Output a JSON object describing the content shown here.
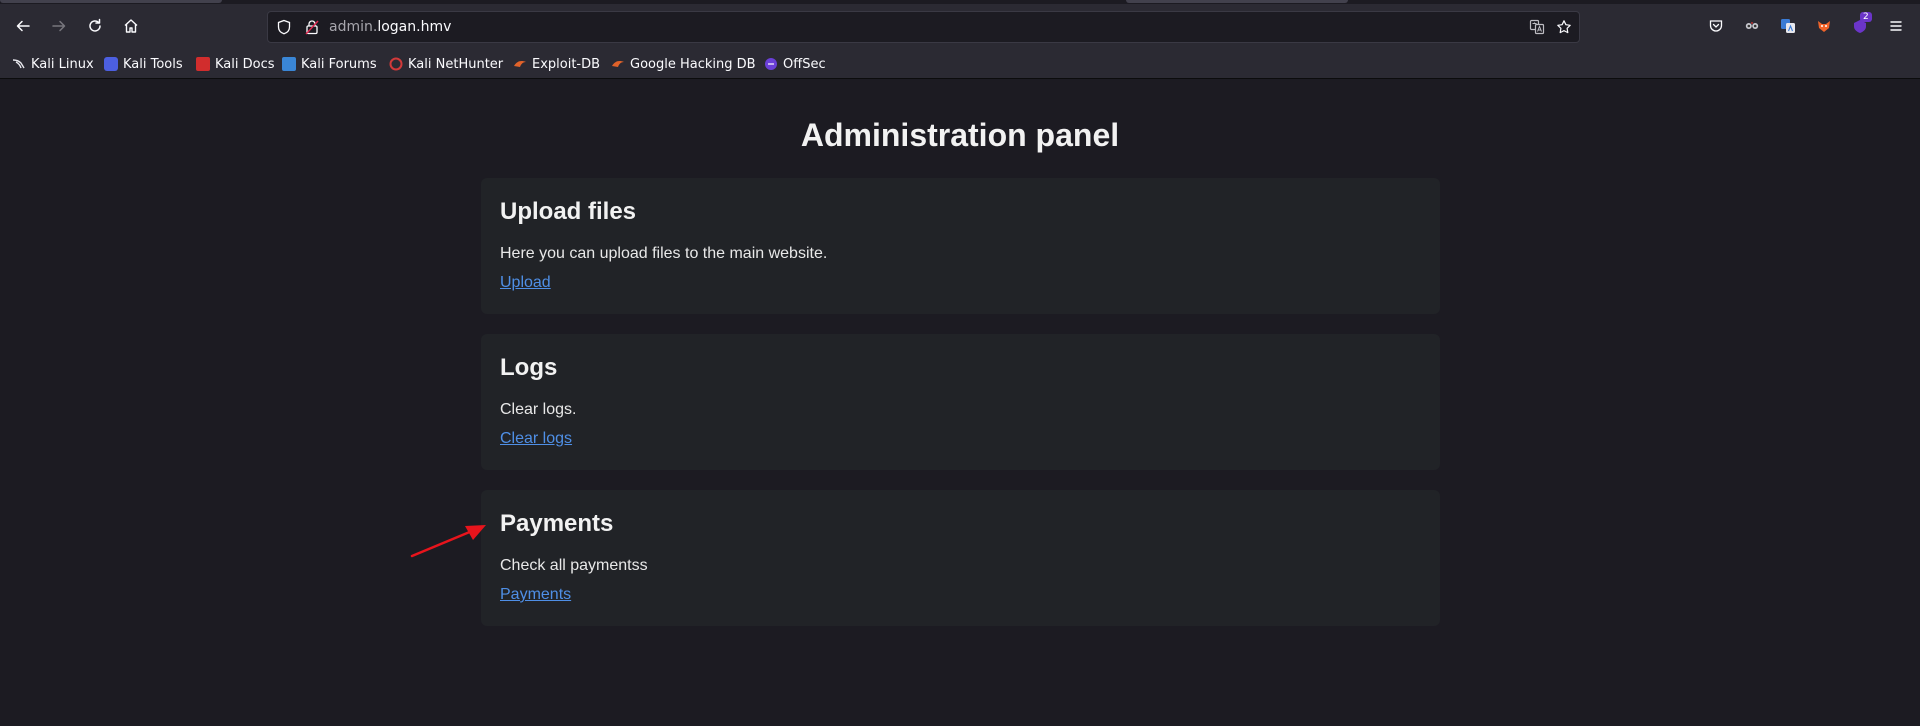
{
  "browser": {
    "url_subdomain": "admin.",
    "url_domain": "logan.hmv",
    "extension_badge": "2",
    "bookmarks": [
      {
        "label": "Kali Linux",
        "color": "#3b7bd0"
      },
      {
        "label": "Kali Tools",
        "color": "#4c5fe0"
      },
      {
        "label": "Kali Docs",
        "color": "#d12d2d"
      },
      {
        "label": "Kali Forums",
        "color": "#3a86d6"
      },
      {
        "label": "Kali NetHunter",
        "color": "#d23a3a"
      },
      {
        "label": "Exploit-DB",
        "color": "#e0622a"
      },
      {
        "label": "Google Hacking DB",
        "color": "#e0622a"
      },
      {
        "label": "OffSec",
        "color": "#6a3fd8"
      }
    ]
  },
  "page": {
    "title": "Administration panel",
    "cards": [
      {
        "heading": "Upload files",
        "text": "Here you can upload files to the main website.",
        "link": "Upload"
      },
      {
        "heading": "Logs",
        "text": "Clear logs.",
        "link": "Clear logs"
      },
      {
        "heading": "Payments",
        "text": "Check all paymentss",
        "link": "Payments"
      }
    ]
  },
  "colors": {
    "link": "#4f8fe6",
    "annotation_arrow": "#e8141c"
  }
}
